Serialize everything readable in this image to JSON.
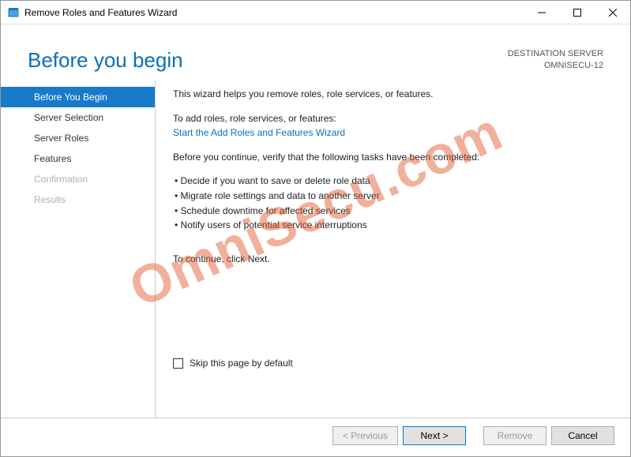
{
  "titlebar": {
    "title": "Remove Roles and Features Wizard"
  },
  "header": {
    "title": "Before you begin",
    "dest_label": "DESTINATION SERVER",
    "dest_value": "OMNISECU-12"
  },
  "sidebar": {
    "items": [
      {
        "label": "Before You Begin",
        "active": true
      },
      {
        "label": "Server Selection"
      },
      {
        "label": "Server Roles"
      },
      {
        "label": "Features"
      },
      {
        "label": "Confirmation",
        "disabled": true
      },
      {
        "label": "Results",
        "disabled": true
      }
    ]
  },
  "content": {
    "intro": "This wizard helps you remove roles, role services, or features.",
    "add_label": "To add roles, role services, or features:",
    "add_link": "Start the Add Roles and Features Wizard",
    "verify_label": "Before you continue, verify that the following tasks have been completed:",
    "bullets": [
      "Decide if you want to save or delete role data",
      "Migrate role settings and data to another server",
      "Schedule downtime for affected services",
      "Notify users of potential service interruptions"
    ],
    "continue_label": "To continue, click Next.",
    "skip_label": "Skip this page by default"
  },
  "footer": {
    "previous": "< Previous",
    "next": "Next >",
    "remove": "Remove",
    "cancel": "Cancel"
  },
  "watermark": "OmniSecu.com"
}
